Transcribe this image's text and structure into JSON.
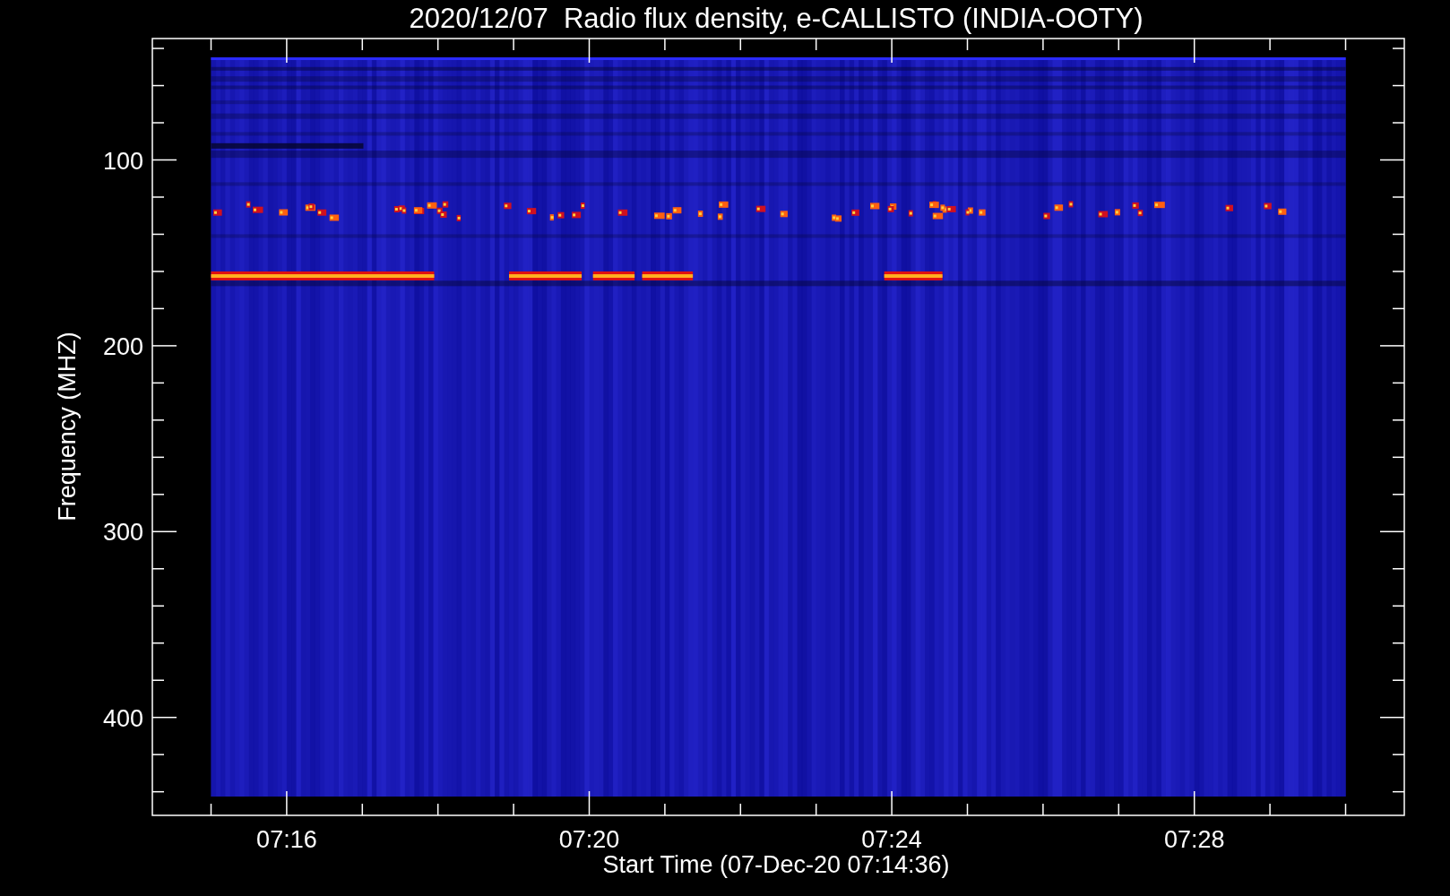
{
  "title": "2020/12/07  Radio flux density, e-CALLISTO (INDIA-OOTY)",
  "y_axis": {
    "label": "Frequency (MHZ)",
    "ticks": [
      "100",
      "200",
      "300",
      "400"
    ]
  },
  "x_axis": {
    "label": "Start Time (07-Dec-20 07:14:36)",
    "ticks": [
      "07:16",
      "07:20",
      "07:24",
      "07:28"
    ]
  }
}
